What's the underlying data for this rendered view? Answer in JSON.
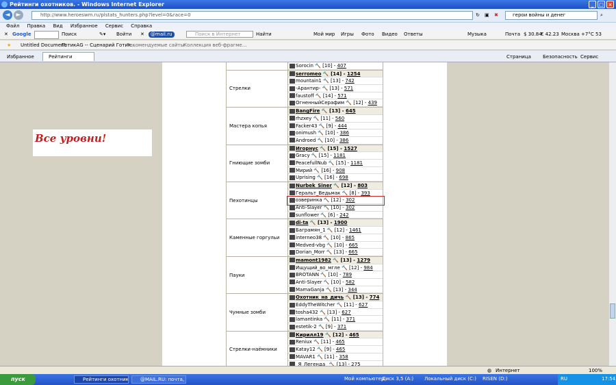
{
  "window": {
    "title": "Рейтинги охотников. - Windows Internet Explorer"
  },
  "address": {
    "url": "http://www.heroeswm.ru/plstats_hunters.php?level=0&race=0"
  },
  "search": {
    "value": "герои войны и денег"
  },
  "menu": [
    "Файл",
    "Правка",
    "Вид",
    "Избранное",
    "Сервис",
    "Справка"
  ],
  "google_toolbar": {
    "search_label": "Поиск",
    "login_label": "Войти"
  },
  "mailru_toolbar": {
    "brand": "@mail.ru",
    "search_placeholder": "Поиск в Интернет",
    "find_label": "Найти",
    "my_world": "Мой мир",
    "games": "Игры",
    "photo": "Фото",
    "video": "Видео",
    "answers": "Ответы",
    "music": "Музыка",
    "mail": "Почта",
    "usd": "$ 30.84",
    "eur": "€ 42.23",
    "weather": "Москва +7°C",
    "count": "53"
  },
  "favorites_bar": {
    "items": [
      "Untitled Document",
      "ГотикАG -- Сценарий Готик...",
      "Рекомендуемые сайты",
      "Коллекция веб-фрагме..."
    ]
  },
  "tabs": {
    "favorites_label": "Избранное",
    "active_tab": "Рейтинги охотников.",
    "page_label": "Страница",
    "safety_label": "Безопасность",
    "service_label": "Сервис"
  },
  "page": {
    "promo": "Все уровни!"
  },
  "groups": [
    {
      "name": "",
      "members": [
        {
          "name": "Sorocin",
          "level": "[10]",
          "score": "407"
        }
      ]
    },
    {
      "name": "Стрелки",
      "members": [
        {
          "name": "serromeo",
          "level": "[14]",
          "score": "1254",
          "leader": true
        },
        {
          "name": "mountain1",
          "level": "[13]",
          "score": "742"
        },
        {
          "name": "-Арантир-",
          "level": "[13]",
          "score": "571"
        },
        {
          "name": "faustoff",
          "level": "[14]",
          "score": "571"
        },
        {
          "name": "ОгненныйСерафим",
          "level": "[12]",
          "score": "439"
        }
      ]
    },
    {
      "name": "Мастера копья",
      "members": [
        {
          "name": "BangFire",
          "level": "[13]",
          "score": "645",
          "leader": true
        },
        {
          "name": "rhzxey",
          "level": "[11]",
          "score": "560"
        },
        {
          "name": "Facker43",
          "level": "[9]",
          "score": "444"
        },
        {
          "name": "onimush",
          "level": "[10]",
          "score": "386"
        },
        {
          "name": "Androed",
          "level": "[10]",
          "score": "386"
        }
      ]
    },
    {
      "name": "Гниющие зомби",
      "members": [
        {
          "name": "Игорнус",
          "level": "[15]",
          "score": "1527",
          "leader": true
        },
        {
          "name": "Gracy",
          "level": "[15]",
          "score": "1181"
        },
        {
          "name": "PeacefullNub",
          "level": "[15]",
          "score": "1181"
        },
        {
          "name": "Мирий",
          "level": "[16]",
          "score": "908"
        },
        {
          "name": "Uprising",
          "level": "[16]",
          "score": "698"
        }
      ]
    },
    {
      "name": "Пехотинцы",
      "members": [
        {
          "name": "Nurbek_Siner",
          "level": "[12]",
          "score": "803",
          "leader": true
        },
        {
          "name": "Геральт_Ведьмак",
          "level": "[8]",
          "score": "393"
        },
        {
          "name": "озверинка",
          "level": "[12]",
          "score": "302"
        },
        {
          "name": "Anti-Slayer",
          "level": "[10]",
          "score": "302"
        },
        {
          "name": "sunflower",
          "level": "[6]",
          "score": "242"
        }
      ]
    },
    {
      "name": "Каменные горгульи",
      "members": [
        {
          "name": "di-ta",
          "level": "[13]",
          "score": "1900",
          "leader": true
        },
        {
          "name": "Баграмян_1",
          "level": "[12]",
          "score": "1461"
        },
        {
          "name": "interneo38",
          "level": "[10]",
          "score": "865"
        },
        {
          "name": "Medved-vbg",
          "level": "[10]",
          "score": "665"
        },
        {
          "name": "Dorian_Morr",
          "level": "[13]",
          "score": "665"
        }
      ]
    },
    {
      "name": "Пауки",
      "members": [
        {
          "name": "mamont1982",
          "level": "[13]",
          "score": "1279",
          "leader": true
        },
        {
          "name": "Ищущий_во_мгле",
          "level": "[12]",
          "score": "984"
        },
        {
          "name": "BROTANN",
          "level": "[10]",
          "score": "789"
        },
        {
          "name": "Anti-Slayer",
          "level": "[10]",
          "score": "582"
        },
        {
          "name": "MamaGanja",
          "level": "[13]",
          "score": "344"
        }
      ]
    },
    {
      "name": "Чумные зомби",
      "members": [
        {
          "name": "Охотник_на_дичь",
          "level": "[13]",
          "score": "774",
          "leader": true
        },
        {
          "name": "EddyTheWitcher",
          "level": "[11]",
          "score": "627"
        },
        {
          "name": "tosha432",
          "level": "[13]",
          "score": "627"
        },
        {
          "name": "lamantinka",
          "level": "[11]",
          "score": "371"
        },
        {
          "name": "estetik-2",
          "level": "[9]",
          "score": "371"
        }
      ]
    },
    {
      "name": "Стрелки-наёмники",
      "members": [
        {
          "name": "Кирилл19",
          "level": "[12]",
          "score": "465",
          "leader": true
        },
        {
          "name": "Reniux",
          "level": "[11]",
          "score": "465"
        },
        {
          "name": "Katay12",
          "level": "[9]",
          "score": "465"
        },
        {
          "name": "MAVAR1",
          "level": "[11]",
          "score": "358"
        },
        {
          "name": "_Я_Легенда_",
          "level": "[13]",
          "score": "275"
        }
      ]
    }
  ],
  "status": {
    "zone": "Интернет",
    "zoom": "100%"
  },
  "taskbar": {
    "start": "пуск",
    "tasks": [
      "Рейтинги охотников....",
      "@MAIL.RU: почта, н..."
    ],
    "my_computer": "Мой компьютер",
    "drive_a": "Диск 3,5 (A:)",
    "drive_c": "Локальный диск (C:)",
    "drive_d": "RISEN (D:)",
    "lang": "RU",
    "clock": "17:54"
  }
}
